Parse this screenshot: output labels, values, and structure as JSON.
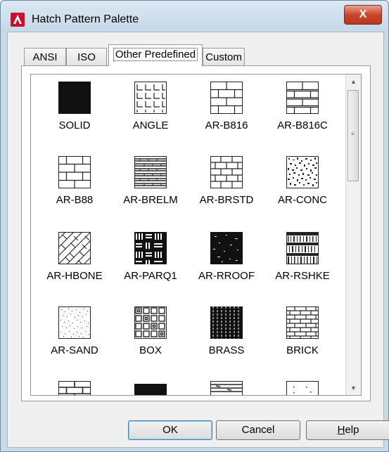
{
  "window": {
    "title": "Hatch Pattern Palette",
    "close_glyph": "X"
  },
  "tabs": [
    {
      "label": "ANSI"
    },
    {
      "label": "ISO"
    },
    {
      "label": "Other Predefined",
      "active": true
    },
    {
      "label": "Custom"
    }
  ],
  "patterns": [
    {
      "label": "SOLID",
      "icon": "solid-icon"
    },
    {
      "label": "ANGLE",
      "icon": "angle-icon"
    },
    {
      "label": "AR-B816",
      "icon": "brick-icon"
    },
    {
      "label": "AR-B816C",
      "icon": "brick-icon"
    },
    {
      "label": "AR-B88",
      "icon": "brick-icon"
    },
    {
      "label": "AR-BRELM",
      "icon": "brelm-icon"
    },
    {
      "label": "AR-BRSTD",
      "icon": "brick-icon"
    },
    {
      "label": "AR-CONC",
      "icon": "concrete-icon"
    },
    {
      "label": "AR-HBONE",
      "icon": "herringbone-icon"
    },
    {
      "label": "AR-PARQ1",
      "icon": "parquet-icon"
    },
    {
      "label": "AR-RROOF",
      "icon": "roof-icon"
    },
    {
      "label": "AR-RSHKE",
      "icon": "shake-icon"
    },
    {
      "label": "AR-SAND",
      "icon": "sand-icon"
    },
    {
      "label": "BOX",
      "icon": "box-icon"
    },
    {
      "label": "BRASS",
      "icon": "brass-icon"
    },
    {
      "label": "BRICK",
      "icon": "brick-icon"
    }
  ],
  "buttons": {
    "ok": "OK",
    "cancel": "Cancel",
    "help_h": "H",
    "help_rest": "elp"
  }
}
